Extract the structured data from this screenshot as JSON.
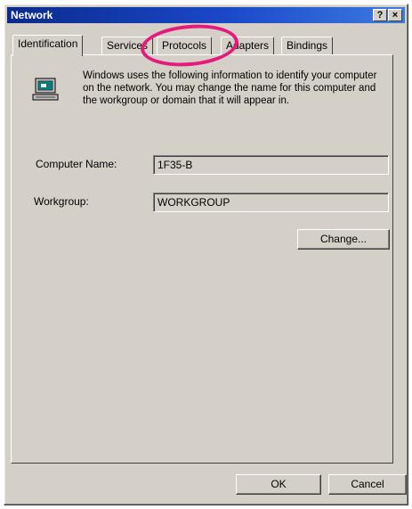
{
  "window": {
    "title": "Network",
    "help_glyph": "?",
    "close_glyph": "×"
  },
  "tabs": [
    {
      "label": "Identification",
      "active": true
    },
    {
      "label": "Services",
      "active": false
    },
    {
      "label": "Protocols",
      "active": false
    },
    {
      "label": "Adapters",
      "active": false
    },
    {
      "label": "Bindings",
      "active": false
    }
  ],
  "identification": {
    "description": "Windows uses the following information to identify your computer on the network.  You may change the name for this computer and the workgroup or domain that it will appear in.",
    "computer_name_label": "Computer Name:",
    "computer_name_value": "1F35-B",
    "workgroup_label": "Workgroup:",
    "workgroup_value": "WORKGROUP",
    "change_button": "Change..."
  },
  "footer": {
    "ok": "OK",
    "cancel": "Cancel"
  },
  "colors": {
    "annotation_circle": "#e6197d",
    "titlebar": "#0b2a8c",
    "face": "#d4d0c8"
  },
  "icons": {
    "computer": "computer-icon"
  }
}
